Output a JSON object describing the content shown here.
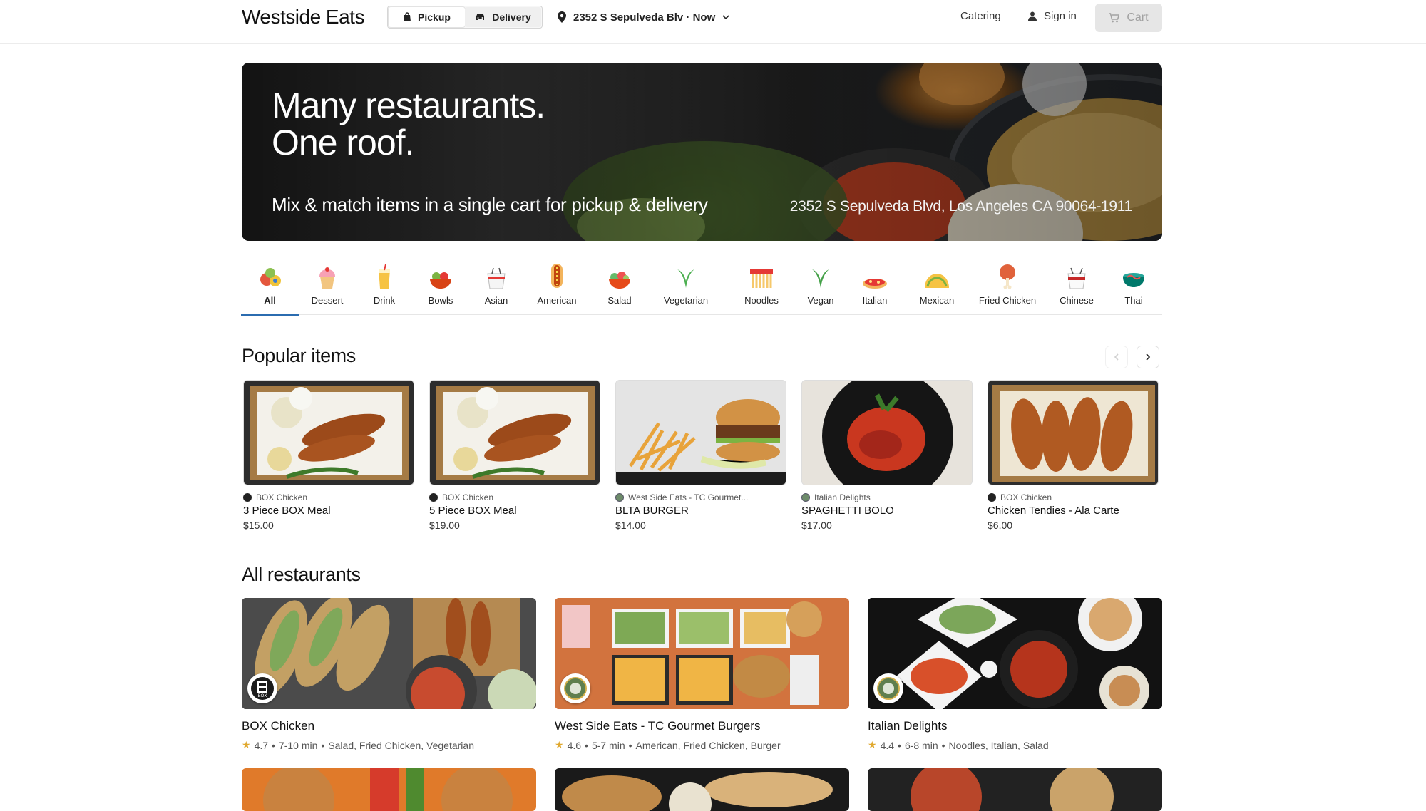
{
  "header": {
    "logo": "Westside Eats",
    "modes": [
      {
        "label": "Pickup",
        "icon": "bag-icon",
        "active": true
      },
      {
        "label": "Delivery",
        "icon": "car-icon",
        "active": false
      }
    ],
    "location": "2352 S Sepulveda Blv · Now",
    "catering": "Catering",
    "sign_in": "Sign in",
    "cart": "Cart"
  },
  "hero": {
    "title_line1": "Many restaurants.",
    "title_line2": "One roof.",
    "subtitle": "Mix & match items in a single cart for pickup & delivery",
    "address": "2352 S Sepulveda Blvd, Los Angeles CA 90064-1911"
  },
  "categories": [
    {
      "label": "All",
      "icon": "all-food-icon",
      "active": true
    },
    {
      "label": "Dessert",
      "icon": "cupcake-icon"
    },
    {
      "label": "Drink",
      "icon": "drink-icon"
    },
    {
      "label": "Bowls",
      "icon": "bowl-icon"
    },
    {
      "label": "Asian",
      "icon": "takeout-icon"
    },
    {
      "label": "American",
      "icon": "hotdog-icon"
    },
    {
      "label": "Salad",
      "icon": "salad-icon"
    },
    {
      "label": "Vegetarian",
      "icon": "leaf-icon"
    },
    {
      "label": "Noodles",
      "icon": "noodles-icon"
    },
    {
      "label": "Vegan",
      "icon": "vegan-icon"
    },
    {
      "label": "Italian",
      "icon": "pizza-icon"
    },
    {
      "label": "Mexican",
      "icon": "taco-icon"
    },
    {
      "label": "Fried Chicken",
      "icon": "drumstick-icon"
    },
    {
      "label": "Chinese",
      "icon": "chinese-takeout-icon"
    },
    {
      "label": "Thai",
      "icon": "thai-bowl-icon"
    }
  ],
  "popular": {
    "title": "Popular items",
    "items": [
      {
        "restaurant": "BOX Chicken",
        "name": "3 Piece BOX Meal",
        "price": "$15.00"
      },
      {
        "restaurant": "BOX Chicken",
        "name": "5 Piece BOX Meal",
        "price": "$19.00"
      },
      {
        "restaurant": "West Side Eats - TC Gourmet...",
        "name": "BLTA BURGER",
        "price": "$14.00"
      },
      {
        "restaurant": "Italian Delights",
        "name": "SPAGHETTI BOLO",
        "price": "$17.00"
      },
      {
        "restaurant": "BOX Chicken",
        "name": "Chicken Tendies - Ala Carte",
        "price": "$6.00"
      }
    ]
  },
  "restaurants": {
    "title": "All restaurants",
    "items": [
      {
        "name": "BOX Chicken",
        "rating": "4.7",
        "time": "7-10 min",
        "tags": "Salad, Fried Chicken, Vegetarian"
      },
      {
        "name": "West Side Eats - TC Gourmet Burgers",
        "rating": "4.6",
        "time": "5-7 min",
        "tags": "American, Fried Chicken, Burger"
      },
      {
        "name": "Italian Delights",
        "rating": "4.4",
        "time": "6-8 min",
        "tags": "Noodles, Italian, Salad"
      }
    ]
  },
  "colors": {
    "accent": "#2b6cb0",
    "star": "#e0a82e",
    "cart_disabled": "#e6e6e6"
  }
}
